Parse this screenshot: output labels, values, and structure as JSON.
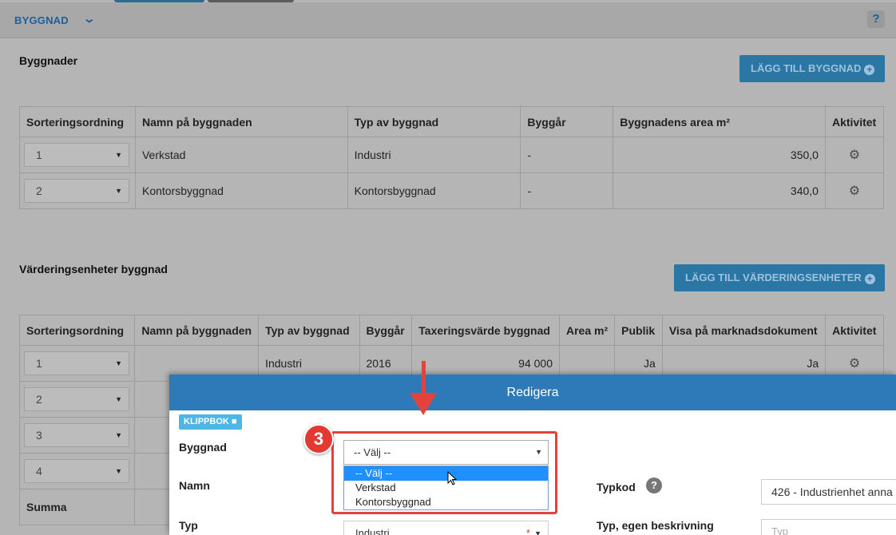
{
  "header": {
    "title": "BYGGNAD",
    "help": "?"
  },
  "buildings": {
    "title": "Byggnader",
    "add_button": "LÄGG TILL BYGGNAD",
    "columns": [
      "Sorteringsordning",
      "Namn på byggnaden",
      "Typ av byggnad",
      "Byggår",
      "Byggnadens area m²",
      "Aktivitet"
    ],
    "rows": [
      {
        "order": "1",
        "name": "Verkstad",
        "type": "Industri",
        "year": "-",
        "area": "350,0"
      },
      {
        "order": "2",
        "name": "Kontorsbyggnad",
        "type": "Kontorsbyggnad",
        "year": "-",
        "area": "340,0"
      }
    ]
  },
  "valuation": {
    "title": "Värderingsenheter byggnad",
    "add_button": "LÄGG TILL VÄRDERINGSENHETER",
    "columns": [
      "Sorteringsordning",
      "Namn på byggnaden",
      "Typ av byggnad",
      "Byggår",
      "Taxeringsvärde byggnad",
      "Area m²",
      "Publik",
      "Visa på marknadsdokument",
      "Aktivitet"
    ],
    "rows": [
      {
        "order": "1",
        "name": "",
        "type": "Industri",
        "year": "2016",
        "value": "94 000",
        "area": "",
        "public": "Ja",
        "show": "Ja"
      },
      {
        "order": "2"
      },
      {
        "order": "3"
      },
      {
        "order": "4"
      }
    ],
    "sum_label": "Summa"
  },
  "modal": {
    "title": "Redigera",
    "clipboard": "KLIPPBOK",
    "step_badge": "3",
    "building_label": "Byggnad",
    "building_selected": "-- Välj --",
    "building_options": [
      "-- Välj --",
      "Verkstad",
      "Kontorsbyggnad"
    ],
    "name_label": "Namn",
    "type_label": "Typ",
    "type_value": "Industri",
    "typecode_label": "Typkod",
    "typecode_value": "426 - Industrienhet anna",
    "type_desc_label": "Typ, egen beskrivning",
    "type_desc_placeholder": "Typ"
  },
  "icons": {
    "gear": "gear-icon",
    "chevron": "chevron-down-icon",
    "plus": "plus-circle-icon",
    "cursor": "cursor-icon"
  },
  "colors": {
    "accent": "#2e7ab8",
    "highlight": "#e4423c",
    "option_active": "#1e90ff"
  }
}
